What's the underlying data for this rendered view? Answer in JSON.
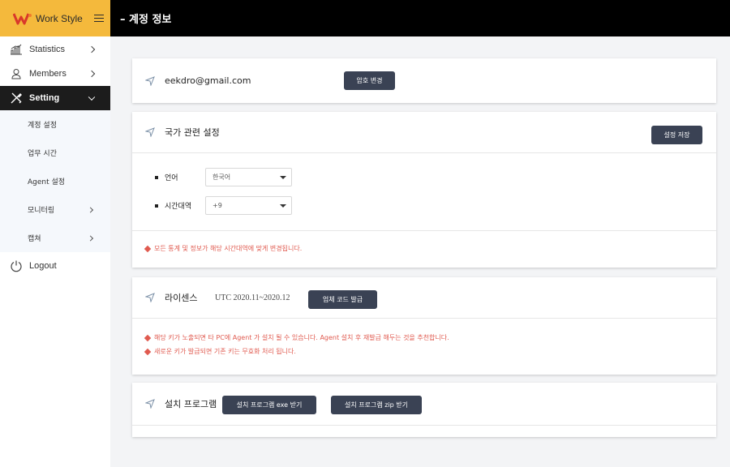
{
  "brand": {
    "name": "Work Style"
  },
  "sidebar": {
    "items": [
      {
        "label": "Statistics"
      },
      {
        "label": "Members"
      },
      {
        "label": "Setting"
      }
    ],
    "subitems": [
      {
        "label": "계정 설정"
      },
      {
        "label": "업무 시간"
      },
      {
        "label": "Agent 설정"
      },
      {
        "label": "모니터링"
      },
      {
        "label": "캡쳐"
      }
    ],
    "logout": "Logout"
  },
  "header": {
    "title": "– 계정 정보"
  },
  "account": {
    "email": "eekdro@gmail.com",
    "change_password": "암호 변경"
  },
  "country": {
    "title": "국가 관련 설정",
    "save": "설정 저장",
    "language_label": "언어",
    "language_value": "한국어",
    "timezone_label": "시간대역",
    "timezone_value": "+9",
    "note": "모든 통계 및 정보가 해당 시간대역에 맞게 변경됩니다."
  },
  "license": {
    "title": "라이센스",
    "period": "UTC 2020.11~2020.12",
    "issue": "업체 코드 발급",
    "note1": "해당 키가 노출되면 타 PC에 Agent 가 설치 될 수 있습니다. Agent 설치 후 재발급 해두는 것을 추천합니다.",
    "note2": "새로운 키가 발급되면 기존 키는 무효화 처리 됩니다."
  },
  "install": {
    "title": "설치 프로그램",
    "exe": "설치 프로그램 exe 받기",
    "zip": "설치 프로그램 zip 받기"
  },
  "colors": {
    "brand": "#f4b93c",
    "button": "#3a4254",
    "warning": "#e05a4f"
  }
}
